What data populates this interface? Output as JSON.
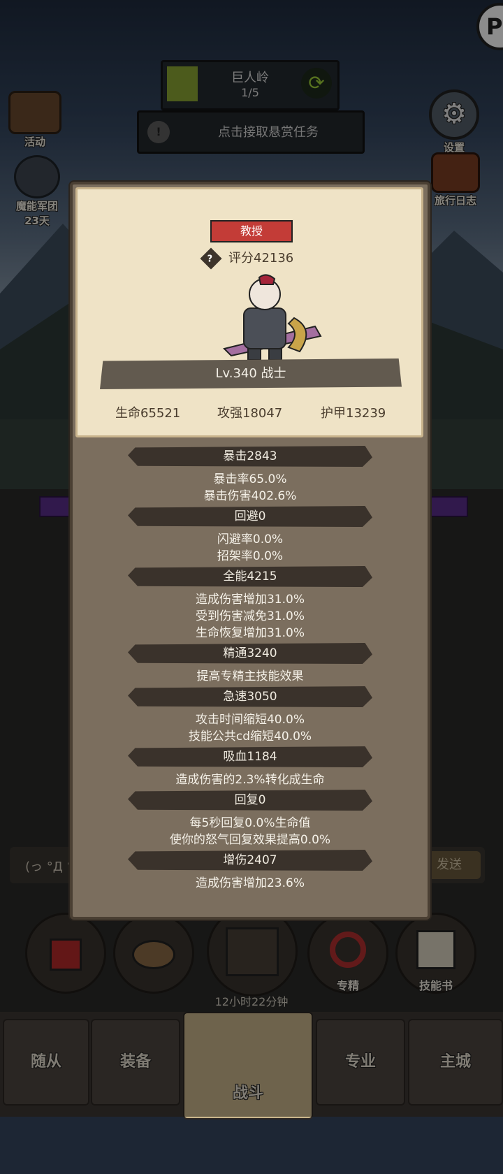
{
  "hud": {
    "quest_title": "巨人岭",
    "quest_progress": "1/5",
    "bounty_text": "点击接取悬赏任务",
    "left_buttons": [
      {
        "label": "活动",
        "icon": "scroll-icon"
      },
      {
        "label": "魔能军团",
        "sub": "23天",
        "icon": "helmet-icon"
      }
    ],
    "right_buttons": [
      {
        "label": "设置",
        "icon": "gear-icon"
      },
      {
        "label": "旅行日志",
        "icon": "book-icon"
      }
    ]
  },
  "panel": {
    "rank_badge": "教授",
    "score": "评分42136",
    "level_class": "Lv.340 战士",
    "hp": "生命65521",
    "attack": "攻强18047",
    "armor": "护甲13239",
    "stats": [
      {
        "header": "暴击2843",
        "lines": [
          "暴击率65.0%",
          "暴击伤害402.6%"
        ]
      },
      {
        "header": "回避0",
        "lines": [
          "闪避率0.0%",
          "招架率0.0%"
        ]
      },
      {
        "header": "全能4215",
        "lines": [
          "造成伤害增加31.0%",
          "受到伤害减免31.0%",
          "生命恢复增加31.0%"
        ]
      },
      {
        "header": "精通3240",
        "lines": [
          "提高专精主技能效果"
        ]
      },
      {
        "header": "急速3050",
        "lines": [
          "攻击时间缩短40.0%",
          "技能公共cd缩短40.0%"
        ]
      },
      {
        "header": "吸血1184",
        "lines": [
          "造成伤害的2.3%转化成生命"
        ]
      },
      {
        "header": "回复0",
        "lines": [
          "每5秒回复0.0%生命值",
          "使你的怒气回复效果提高0.0%"
        ]
      },
      {
        "header": "增伤2407",
        "lines": [
          "造成伤害增加23.6%"
        ]
      }
    ]
  },
  "chat": {
    "placeholder": "(っ °Д °",
    "send": "发送"
  },
  "bottom": {
    "timer": "12小时22分钟",
    "specialize": "专精",
    "skillbook": "技能书",
    "tabs": [
      "随从",
      "装备",
      "战斗",
      "专业",
      "主城"
    ]
  },
  "colors": {
    "rank_badge": "#c33c37",
    "quest_swatch": "#8aa634",
    "panel": "#7b6e5e",
    "card": "#efe3c6"
  }
}
